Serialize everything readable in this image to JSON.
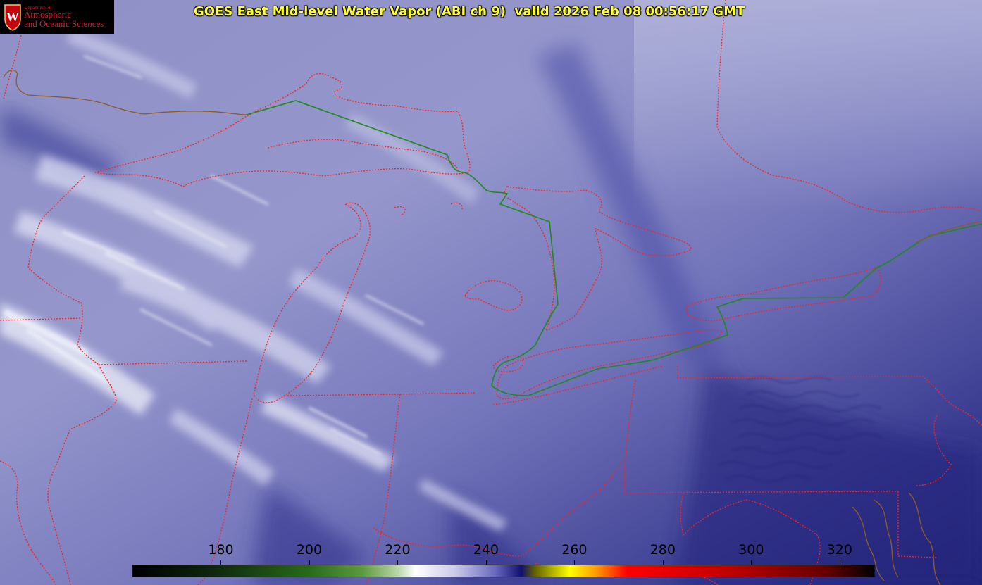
{
  "title": "GOES East Mid-level Water Vapor (ABI ch 9)  valid 2026 Feb 08 00:56:17 GMT",
  "logo": {
    "dept_label": "Department of",
    "line1": "Atmospheric",
    "line2": "and Oceanic Sciences",
    "seal_letter": "W",
    "color": "#c5050c"
  },
  "colorbar": {
    "min": 160,
    "max": 328,
    "ticks": [
      {
        "value": 180,
        "label": "180"
      },
      {
        "value": 200,
        "label": "200"
      },
      {
        "value": 220,
        "label": "220"
      },
      {
        "value": 240,
        "label": "240"
      },
      {
        "value": 260,
        "label": "260"
      },
      {
        "value": 280,
        "label": "280"
      },
      {
        "value": 300,
        "label": "300"
      },
      {
        "value": 320,
        "label": "320"
      }
    ],
    "stops": [
      {
        "value": 160,
        "color": "#000000"
      },
      {
        "value": 178,
        "color": "#0e260e"
      },
      {
        "value": 200,
        "color": "#286b1a"
      },
      {
        "value": 212,
        "color": "#5c9a3e"
      },
      {
        "value": 220,
        "color": "#b9d6a8"
      },
      {
        "value": 224,
        "color": "#ffffff"
      },
      {
        "value": 233,
        "color": "#c9c9ea"
      },
      {
        "value": 242,
        "color": "#6a6ac0"
      },
      {
        "value": 248,
        "color": "#101070"
      },
      {
        "value": 251,
        "color": "#606000"
      },
      {
        "value": 259,
        "color": "#ffff00"
      },
      {
        "value": 265,
        "color": "#ff9900"
      },
      {
        "value": 272,
        "color": "#ff0000"
      },
      {
        "value": 295,
        "color": "#c00000"
      },
      {
        "value": 318,
        "color": "#600000"
      },
      {
        "value": 328,
        "color": "#000000"
      }
    ]
  },
  "colors": {
    "state_borders": "#ff2020",
    "international_border": "#1f8a1f",
    "coastline": "#8b5a2b",
    "title_text": "#ffff33"
  }
}
